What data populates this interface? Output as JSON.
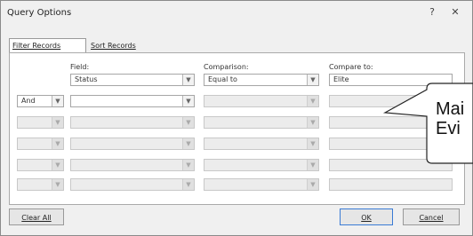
{
  "window": {
    "title": "Query Options",
    "help_glyph": "?",
    "close_glyph": "✕"
  },
  "tabs": [
    {
      "label": "Filter Records",
      "active": true
    },
    {
      "label": "Sort Records",
      "active": false
    }
  ],
  "columns": {
    "field": "Field:",
    "comparison": "Comparison:",
    "compare_to": "Compare to:"
  },
  "rows": [
    {
      "conj": "",
      "field": "Status",
      "comparison": "Equal to",
      "compare_to": "Elite"
    },
    {
      "conj": "And",
      "field": "",
      "comparison": "",
      "compare_to": ""
    },
    {
      "conj": "",
      "field": "",
      "comparison": "",
      "compare_to": ""
    },
    {
      "conj": "",
      "field": "",
      "comparison": "",
      "compare_to": ""
    },
    {
      "conj": "",
      "field": "",
      "comparison": "",
      "compare_to": ""
    },
    {
      "conj": "",
      "field": "",
      "comparison": "",
      "compare_to": ""
    }
  ],
  "buttons": {
    "clear_all": "Clear All",
    "ok": "OK",
    "cancel": "Cancel"
  },
  "callout": {
    "line1": "Mai",
    "line2": "Evi"
  },
  "icons": {
    "dropdown": "chevron-down-icon"
  },
  "colors": {
    "dialog_bg": "#f0f0f0",
    "ok_border": "#3a7bd5"
  }
}
